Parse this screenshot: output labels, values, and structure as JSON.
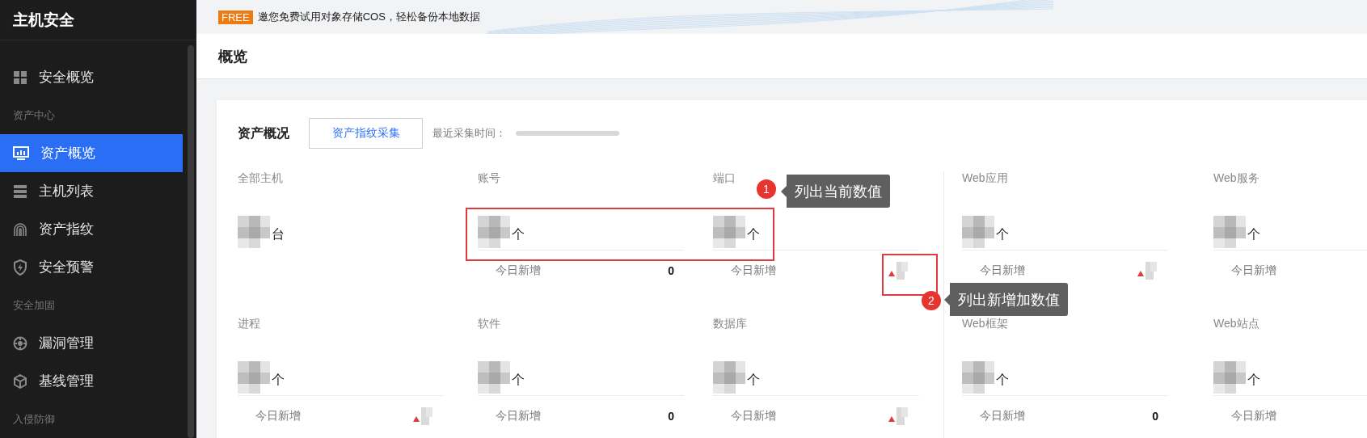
{
  "sidebar": {
    "title": "主机安全",
    "items": [
      {
        "kind": "item",
        "label": "安全概览",
        "selected": false
      },
      {
        "kind": "group",
        "label": "资产中心"
      },
      {
        "kind": "item",
        "label": "资产概览",
        "selected": true
      },
      {
        "kind": "item",
        "label": "主机列表",
        "selected": false
      },
      {
        "kind": "item",
        "label": "资产指纹",
        "selected": false
      },
      {
        "kind": "item",
        "label": "安全预警",
        "selected": false
      },
      {
        "kind": "group",
        "label": "安全加固"
      },
      {
        "kind": "item",
        "label": "漏洞管理",
        "selected": false
      },
      {
        "kind": "item",
        "label": "基线管理",
        "selected": false
      },
      {
        "kind": "group",
        "label": "入侵防御"
      }
    ]
  },
  "banner": {
    "badge": "FREE",
    "text": "邀您免费试用对象存储COS，轻松备份本地数据"
  },
  "header": {
    "title": "概览"
  },
  "assets": {
    "title": "资产概况",
    "button": "资产指纹采集",
    "time_label": "最近采集时间：",
    "stats": [
      {
        "label": "全部主机",
        "unit": "台"
      },
      {
        "label": "账号",
        "unit": "个",
        "today": {
          "label": "今日新增",
          "kind": "zero",
          "value": "0"
        }
      },
      {
        "label": "端口",
        "unit": "个",
        "today": {
          "label": "今日新增",
          "kind": "up"
        }
      },
      {
        "label": "Web应用",
        "unit": "个",
        "today": {
          "label": "今日新增",
          "kind": "up"
        }
      },
      {
        "label": "Web服务",
        "unit": "个",
        "today": {
          "label": "今日新增",
          "kind": "blank"
        }
      },
      {
        "label": "进程",
        "unit": "个",
        "today": {
          "label": "今日新增",
          "kind": "up"
        }
      },
      {
        "label": "软件",
        "unit": "个",
        "today": {
          "label": "今日新增",
          "kind": "zero",
          "value": "0"
        }
      },
      {
        "label": "数据库",
        "unit": "个",
        "today": {
          "label": "今日新增",
          "kind": "up"
        }
      },
      {
        "label": "Web框架",
        "unit": "个",
        "today": {
          "label": "今日新增",
          "kind": "zero",
          "value": "0"
        }
      },
      {
        "label": "Web站点",
        "unit": "个",
        "today": {
          "label": "今日新增",
          "kind": "blank"
        }
      }
    ]
  },
  "annotations": [
    {
      "number": "1",
      "text": "列出当前数值"
    },
    {
      "number": "2",
      "text": "列出新增加数值"
    }
  ]
}
